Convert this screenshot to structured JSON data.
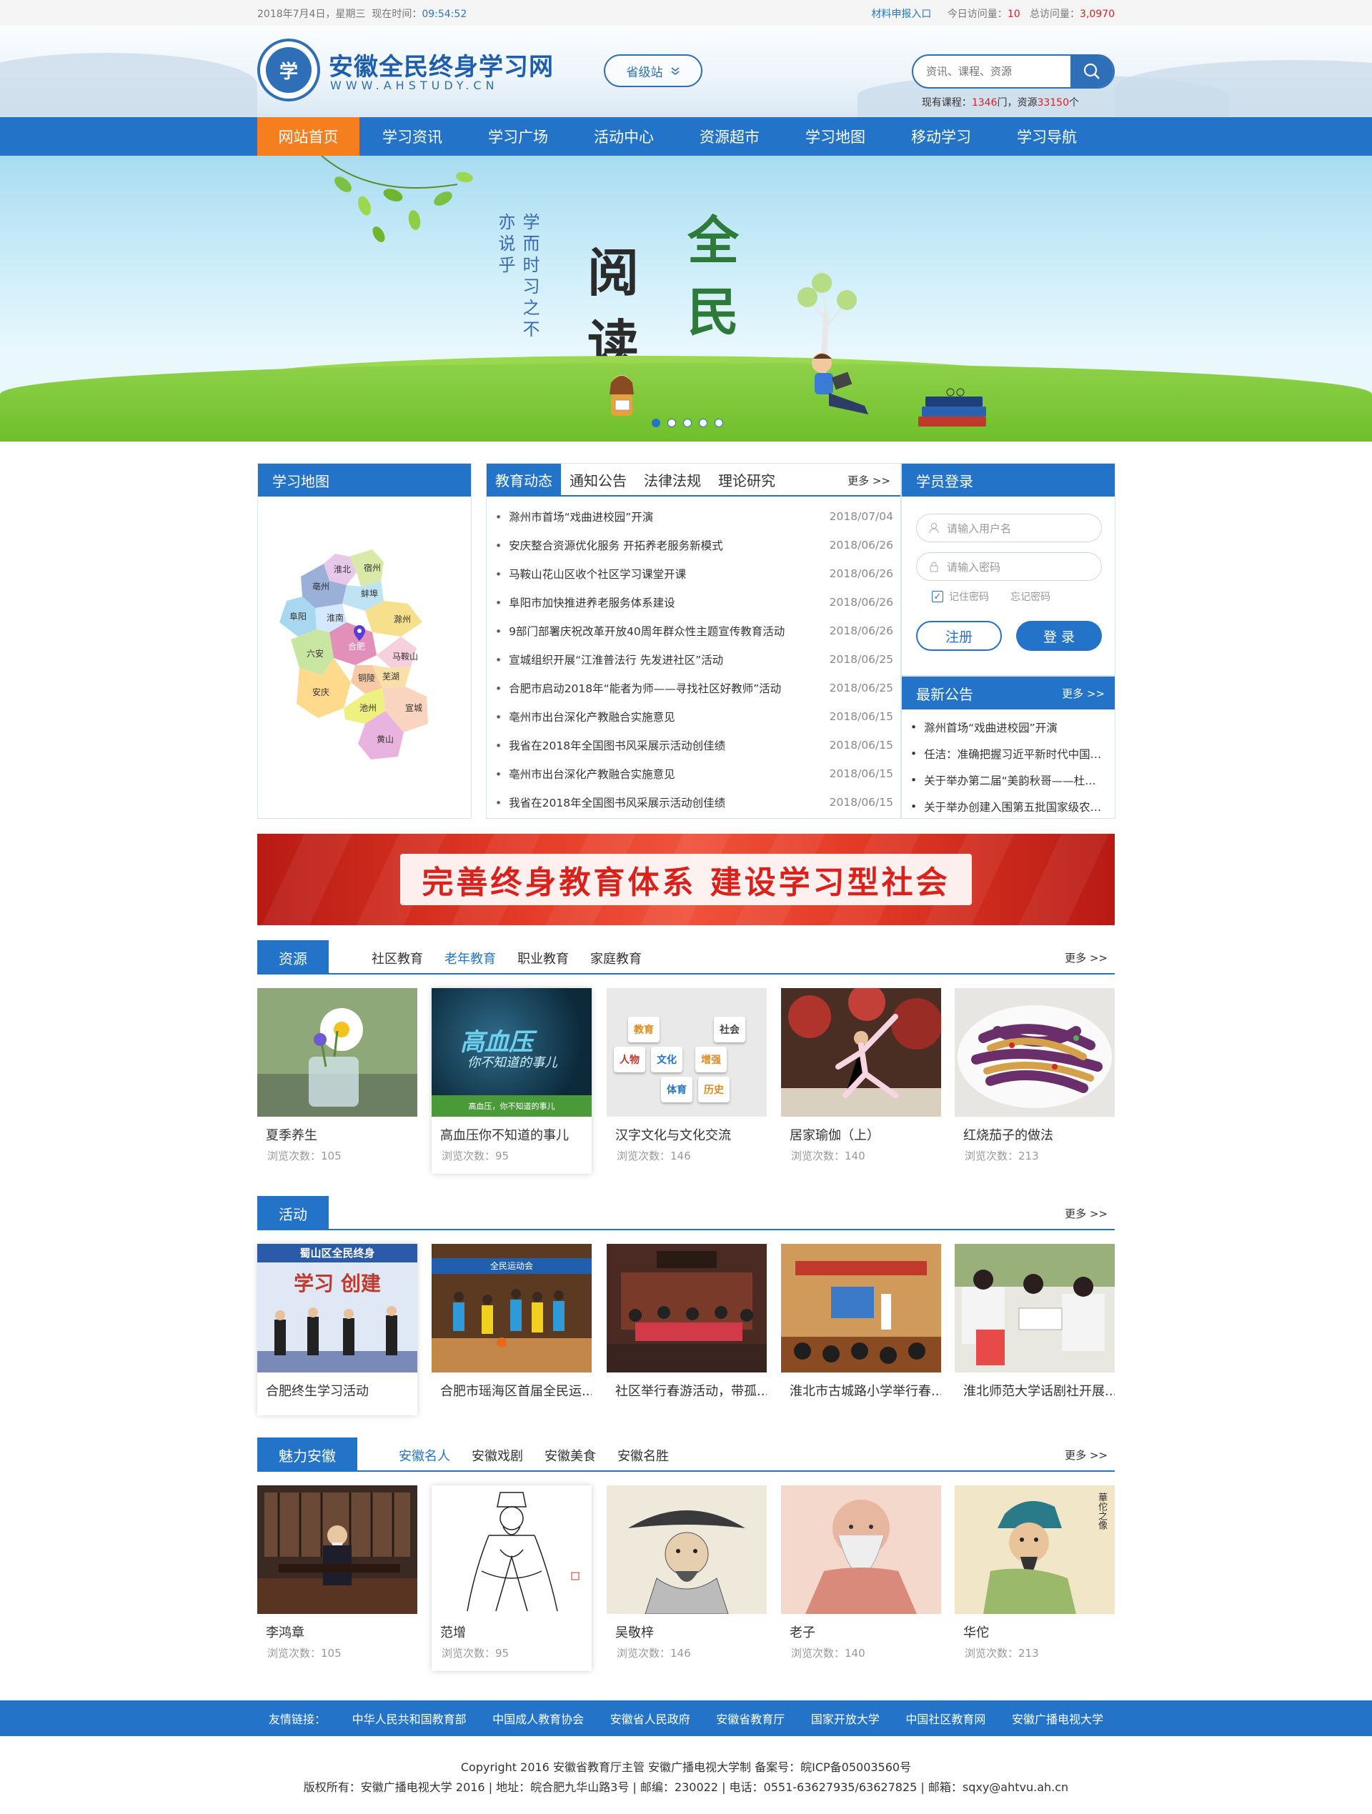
{
  "topbar": {
    "date": "2018年7月4日，星期三",
    "time_label": "现在时间：",
    "time": "09:54:52",
    "report_link": "材料申报入口",
    "today_label": "今日访问量：",
    "today_count": "10",
    "total_label": "总访问量：",
    "total_count": "3,0970"
  },
  "header": {
    "logo_badge": "学",
    "site_name": "安徽全民终身学习网",
    "site_url": "WWW.AHSTUDY.CN",
    "province_label": "省级站",
    "search_placeholder": "资讯、课程、资源",
    "stats_prefix": "现有课程：",
    "course_count": "1346",
    "stats_mid": "门，资源",
    "resource_count": "33150",
    "stats_suffix": "个"
  },
  "nav": [
    "网站首页",
    "学习资讯",
    "学习广场",
    "活动中心",
    "资源超市",
    "学习地图",
    "移动学习",
    "学习导航"
  ],
  "banner": {
    "big_chars_1": [
      "阅",
      "读"
    ],
    "big_chars_2": [
      "全",
      "民"
    ],
    "poem": "学而时习之不亦说乎"
  },
  "map": {
    "title": "学习地图",
    "cities": [
      "淮北",
      "宿州",
      "亳州",
      "蚌埠",
      "阜阳",
      "淮南",
      "滁州",
      "合肥",
      "六安",
      "马鞍山",
      "芜湖",
      "铜陵",
      "安庆",
      "池州",
      "宣城",
      "黄山"
    ]
  },
  "news": {
    "tabs": [
      "教育动态",
      "通知公告",
      "法律法规",
      "理论研究"
    ],
    "more": "更多 >>",
    "items": [
      {
        "title": "滁州市首场“戏曲进校园”开演",
        "date": "2018/07/04"
      },
      {
        "title": "安庆整合资源优化服务 开拓养老服务新模式",
        "date": "2018/06/26"
      },
      {
        "title": "马鞍山花山区收个社区学习课堂开课",
        "date": "2018/06/26"
      },
      {
        "title": "阜阳市加快推进养老服务体系建设",
        "date": "2018/06/26"
      },
      {
        "title": "9部门部署庆祝改革开放40周年群众性主题宣传教育活动",
        "date": "2018/06/26"
      },
      {
        "title": "宣城组织开展“江淮普法行 先发进社区”活动",
        "date": "2018/06/25"
      },
      {
        "title": "合肥市启动2018年“能者为师——寻找社区好教师”活动",
        "date": "2018/06/25"
      },
      {
        "title": "亳州市出台深化产教融合实施意见",
        "date": "2018/06/15"
      },
      {
        "title": "我省在2018年全国图书风采展示活动创佳绩",
        "date": "2018/06/15"
      },
      {
        "title": "亳州市出台深化产教融合实施意见",
        "date": "2018/06/15"
      },
      {
        "title": "我省在2018年全国图书风采展示活动创佳绩",
        "date": "2018/06/15"
      }
    ]
  },
  "login": {
    "title": "学员登录",
    "username_placeholder": "请输入用户名",
    "password_placeholder": "请输入密码",
    "remember": "记住密码",
    "forget": "忘记密码",
    "register": "注册",
    "login": "登 录"
  },
  "notice": {
    "title": "最新公告",
    "more": "更多 >>",
    "items": [
      "滁州首场“戏曲进校园”开演",
      "任洁：准确把握习近平新时代中国…",
      "关于举办第二届“美韵秋哥——杜…",
      "关于举办创建入围第五批国家级农…"
    ]
  },
  "slogan": "完善终身教育体系  建设学习型社会",
  "resources": {
    "title": "资源",
    "tabs": [
      "社区教育",
      "老年教育",
      "职业教育",
      "家庭教育"
    ],
    "active_tab": 1,
    "more": "更多 >>",
    "cards": [
      {
        "name": "夏季养生",
        "views": "浏览次数：105"
      },
      {
        "name": "高血压你不知道的事儿",
        "views": "浏览次数：95"
      },
      {
        "name": "汉字文化与文化交流",
        "views": "浏览次数：146"
      },
      {
        "name": "居家瑜伽（上）",
        "views": "浏览次数：140"
      },
      {
        "name": "红烧茄子的做法",
        "views": "浏览次数：213"
      }
    ],
    "img_text": {
      "tv_title": "高血压",
      "tv_sub": "你不知道的事儿",
      "tv_caption": "高血压，你不知道的事儿"
    },
    "tiles": [
      "教育",
      "社会",
      "人物",
      "文化",
      "增强",
      "体育",
      "历史"
    ]
  },
  "activities": {
    "title": "活动",
    "more": "更多 >>",
    "cards": [
      {
        "name": "合肥终生学习活动"
      },
      {
        "name": "合肥市瑶海区首届全民运..."
      },
      {
        "name": "社区举行春游活动，带孤..."
      },
      {
        "name": "淮北市古城路小学举行春..."
      },
      {
        "name": "淮北师范大学话剧社开展..."
      }
    ],
    "img_text": {
      "stage_banner": "蜀山区全民终身",
      "stage_sub": "学习 创建",
      "bball_banner": "全民运动会"
    }
  },
  "charm": {
    "title": "魅力安徽",
    "tabs": [
      "安徽名人",
      "安徽戏剧",
      "安徽美食",
      "安徽名胜"
    ],
    "active_tab": 0,
    "more": "更多 >>",
    "cards": [
      {
        "name": "李鸿章",
        "views": "浏览次数：105"
      },
      {
        "name": "范增",
        "views": "浏览次数：95"
      },
      {
        "name": "吴敬梓",
        "views": "浏览次数：146"
      },
      {
        "name": "老子",
        "views": "浏览次数：140"
      },
      {
        "name": "华佗",
        "views": "浏览次数：213"
      }
    ],
    "img_text": {
      "huatuo_caption": "華佗之像"
    }
  },
  "footer": {
    "links_label": "友情链接：",
    "links": [
      "中华人民共和国教育部",
      "中国成人教育协会",
      "安徽省人民政府",
      "安徽省教育厅",
      "国家开放大学",
      "中国社区教育网",
      "安徽广播电视大学"
    ],
    "line1": "Copyright 2016 安徽省教育厅主管 安徽广播电视大学制 备案号：皖ICP备05003560号",
    "line2": "版权所有：安徽广播电视大学 2016 | 地址：皖合肥九华山路3号 | 邮编：230022 | 电话：0551-63627935/63627825 | 邮箱：sqxy@ahtvu.ah.cn"
  },
  "colors": {
    "primary": "#2374c8",
    "accent": "#f57f1e",
    "highlight": "#e02020"
  }
}
